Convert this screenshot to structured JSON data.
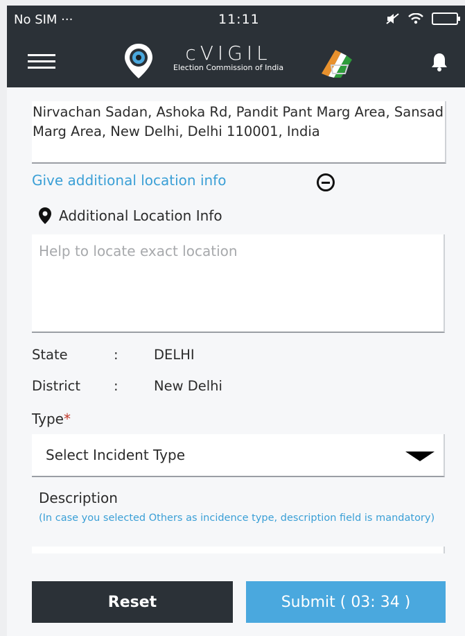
{
  "status_bar": {
    "carrier": "No SIM ···",
    "time": "11:11"
  },
  "app_bar": {
    "title": "cVIGIL",
    "subtitle": "Election Commission of India"
  },
  "location": {
    "address": "Nirvachan Sadan, Ashoka Rd, Pandit Pant Marg Area, Sansad Marg Area, New Delhi, Delhi 110001, India",
    "additional_link": "Give additional location info",
    "additional_label": "Additional Location Info",
    "additional_placeholder": "Help to locate exact location"
  },
  "details": {
    "state_key": "State",
    "state_sep": ":",
    "state_value": "DELHI",
    "district_key": "District",
    "district_sep": ":",
    "district_value": "New Delhi"
  },
  "type": {
    "label": "Type",
    "required_mark": "*",
    "selected": "Select Incident Type"
  },
  "description": {
    "label": "Description",
    "hint": "(In case you selected Others as incidence type, description field is mandatory)"
  },
  "actions": {
    "reset": "Reset",
    "submit": "Submit ( 03: 34 )"
  },
  "colors": {
    "bar": "#2b3137",
    "accent": "#4aa8de",
    "link": "#3a9fd6",
    "required": "#c0392b"
  },
  "icons": [
    "menu-icon",
    "location-eye-icon",
    "voting-hand-icon",
    "bell-icon",
    "mute-icon",
    "wifi-icon",
    "battery-icon",
    "minus-circle-icon",
    "map-pin-icon",
    "dropdown-arrow-icon"
  ]
}
